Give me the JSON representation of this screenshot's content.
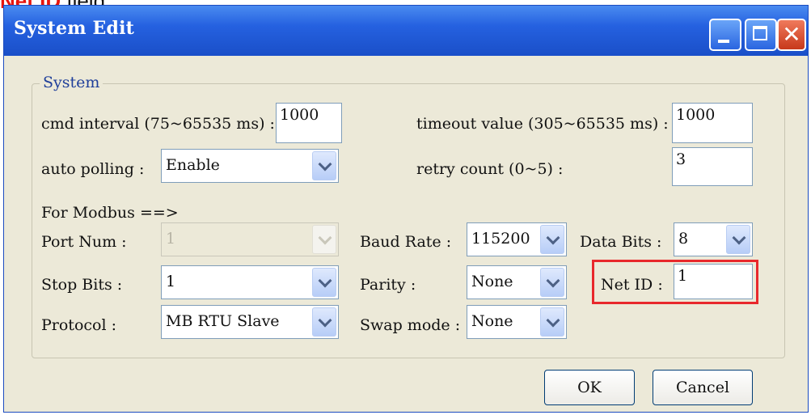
{
  "caption": {
    "highlight": "Net ID",
    "rest": " field."
  },
  "window": {
    "title": "System Edit",
    "controls": {
      "minimize": "minimize-icon",
      "maximize": "maximize-icon",
      "close": "close-icon",
      "close_glyph": "✕"
    }
  },
  "system": {
    "group_label": "System",
    "cmd_interval": {
      "label": "cmd interval (75~65535 ms) :",
      "value": "1000"
    },
    "timeout_value": {
      "label": "timeout value (305~65535 ms) :",
      "value": "1000"
    },
    "auto_polling": {
      "label": "auto polling :",
      "value": "Enable"
    },
    "retry_count": {
      "label": "retry count (0~5) :",
      "value": "3"
    }
  },
  "modbus": {
    "header": "For Modbus ==>",
    "port_num": {
      "label": "Port Num :",
      "value": "1"
    },
    "baud_rate": {
      "label": "Baud Rate :",
      "value": "115200"
    },
    "data_bits": {
      "label": "Data Bits :",
      "value": "8"
    },
    "stop_bits": {
      "label": "Stop Bits :",
      "value": "1"
    },
    "parity": {
      "label": "Parity :",
      "value": "None"
    },
    "net_id": {
      "label": "Net ID :",
      "value": "1"
    },
    "protocol": {
      "label": "Protocol :",
      "value": "MB RTU Slave"
    },
    "swap_mode": {
      "label": "Swap mode :",
      "value": "None"
    }
  },
  "buttons": {
    "ok": "OK",
    "cancel": "Cancel"
  },
  "colors": {
    "title_bar": "#2561e0",
    "highlight": "#e8282c",
    "caption_accent": "#e8140c",
    "dialog_bg": "#ece9d8"
  }
}
